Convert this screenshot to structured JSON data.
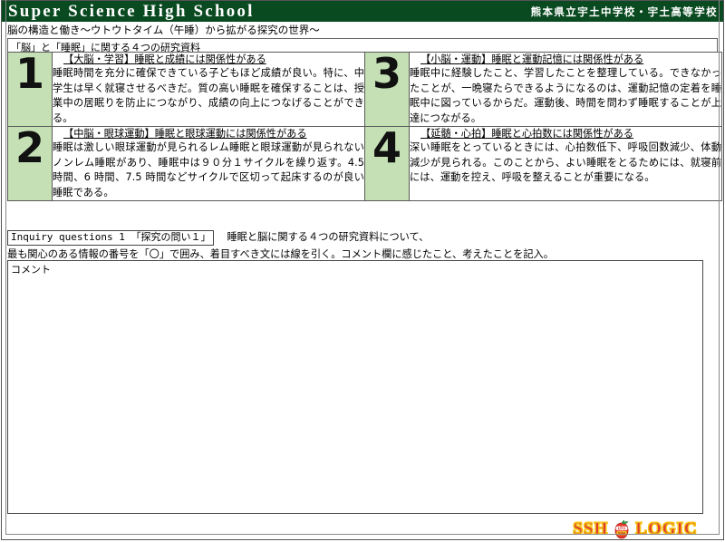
{
  "header": {
    "title": "Super Science High School",
    "school": "熊本県立宇土中学校・宇土高等学校"
  },
  "subtitle": "脳の構造と働き～ウトウトタイム（午睡）から拡がる探究の世界～",
  "section_title": "「脳」と「睡眠」に関する４つの研究資料",
  "cards": [
    {
      "number": "1",
      "heading": "【大脳・学習】睡眠と成績には関係性がある",
      "body": "睡眠時間を充分に確保できている子どもほど成績が良い。特に、中学生は早く就寝させるべきだ。質の高い睡眠を確保することは、授業中の居眠りを防止につながり、成績の向上につなげることができる。"
    },
    {
      "number": "3",
      "heading": "【小脳・運動】睡眠と運動記憶には関係性がある",
      "body": "睡眠中に経験したこと、学習したことを整理している。できなかったことが、一晩寝たらできるようになるのは、運動記憶の定着を睡眠中に図っているからだ。運動後、時間を問わず睡眠することが上達につながる。"
    },
    {
      "number": "2",
      "heading": "【中脳・眼球運動】睡眠と眼球運動には関係性がある",
      "body": "睡眠は激しい眼球運動が見られるレム睡眠と眼球運動が見られないノンレム睡眠があり、睡眠中は９０分１サイクルを繰り返す。4.5 時間、6 時間、7.5 時間などサイクルで区切って起床するのが良い睡眠である。"
    },
    {
      "number": "4",
      "heading": "【延髄・心拍】睡眠と心拍数には関係性がある",
      "body": "深い睡眠をとっているときには、心拍数低下、呼吸回数減少、体動減少が見られる。このことから、よい睡眠をとるためには、就寝前には、運動を控え、呼吸を整えることが重要になる。"
    }
  ],
  "inquiry": {
    "tag": "Inquiry questions 1 「探究の問い１」",
    "line1": "睡眠と脳に関する４つの研究資料について、",
    "line2": "最も関心のある情報の番号を「〇」で囲み、着目すべき文には線を引く。コメント欄に感じたこと、考えたことを記入。"
  },
  "comment": {
    "value": "コメント",
    "placeholder": "コメント"
  },
  "footer": {
    "logo_left": "SSH",
    "logo_right": "LOGIC",
    "apple_top_text": "UTO",
    "apple_bottom_text": "SSH"
  },
  "colors": {
    "header_green": "#0a4a20",
    "cell_green": "#c5e0b4",
    "logo_red": "#e03a2f",
    "logo_yellow": "#f5c518"
  }
}
